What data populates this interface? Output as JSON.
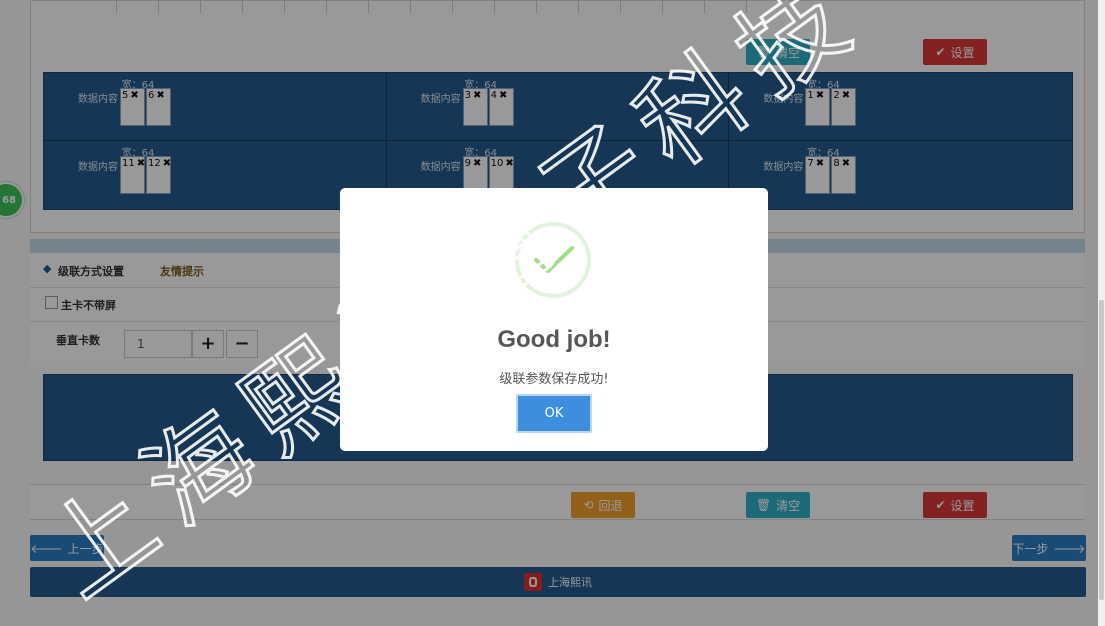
{
  "toolbar_top": {
    "clear_label": "清空",
    "set_label": "设置"
  },
  "layout": {
    "width_label": "宽：64",
    "data_label": "数据内容",
    "cells": [
      {
        "cards": [
          {
            "num": "5"
          },
          {
            "num": "6"
          }
        ]
      },
      {
        "cards": [
          {
            "num": "3"
          },
          {
            "num": "4"
          }
        ]
      },
      {
        "cards": [
          {
            "num": "1"
          },
          {
            "num": "2"
          }
        ]
      },
      {
        "cards": [
          {
            "num": "11"
          },
          {
            "num": "12"
          }
        ]
      },
      {
        "cards": [
          {
            "num": "9"
          },
          {
            "num": "10"
          }
        ]
      },
      {
        "cards": [
          {
            "num": "7"
          },
          {
            "num": "8"
          }
        ]
      }
    ],
    "remove_glyph": "✖"
  },
  "cascade": {
    "title": "级联方式设置",
    "tip_link": "友情提示",
    "main_card_label": "主卡不带屏",
    "vertical_count_label": "垂直卡数",
    "vertical_count_value": "1",
    "plus": "+",
    "minus": "−"
  },
  "toolbar_bottom": {
    "back_label": "回退",
    "clear_label": "清空",
    "set_label": "设置"
  },
  "nav": {
    "prev_label": "上一步",
    "next_label": "下一步"
  },
  "footer": {
    "brand": "上海熙讯"
  },
  "side_badge": "68",
  "modal": {
    "title": "Good job!",
    "message": "级联参数保存成功!",
    "ok_label": "OK"
  },
  "watermark": "上海熙讯电子科技",
  "colors": {
    "accent_blue": "#245a8e",
    "teal": "#2fb1c6",
    "red": "#d93a3a",
    "orange": "#f3a12a",
    "success_green": "#a5dc86"
  }
}
